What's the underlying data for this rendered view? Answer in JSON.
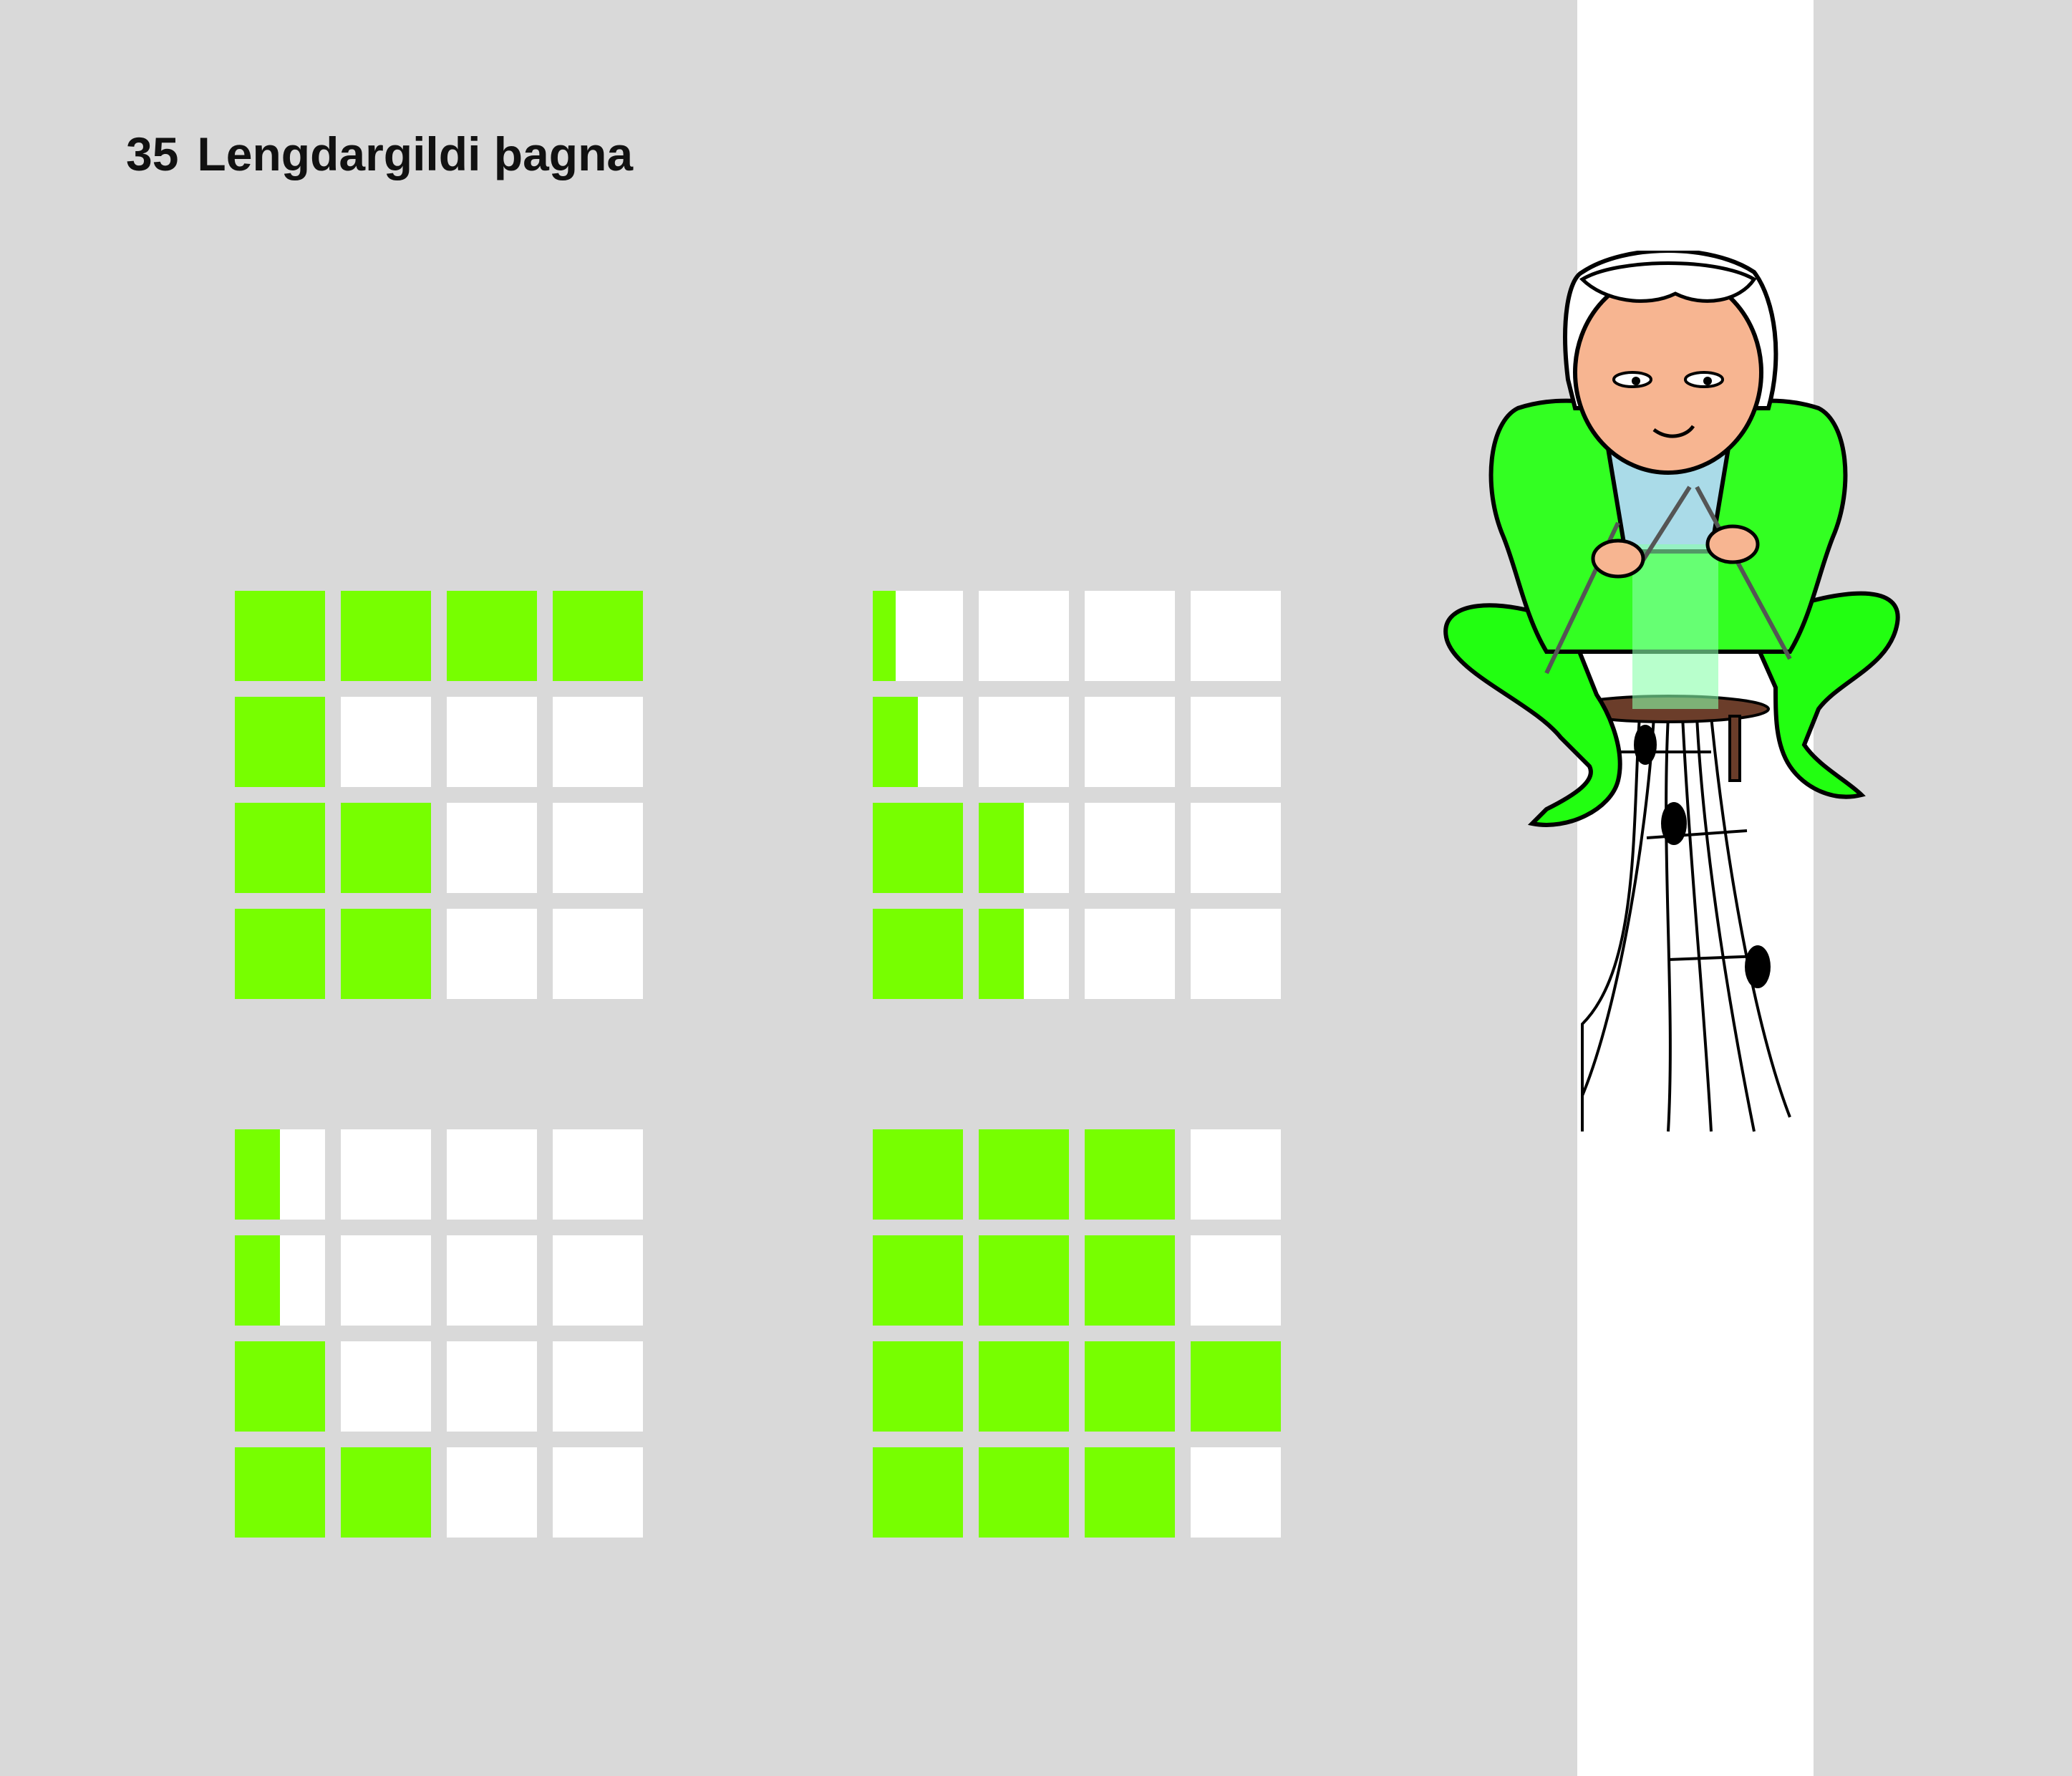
{
  "colors": {
    "background": "#d9d9d9",
    "fill": "#77ff00",
    "empty": "#ffffff",
    "strip": "#ffffff",
    "text": "#111111"
  },
  "header": {
    "number": "35",
    "title": "Lengdargildi þagna"
  },
  "grids": [
    {
      "position": "top-left",
      "fill": [
        [
          1,
          1,
          1,
          1
        ],
        [
          1,
          0,
          0,
          0
        ],
        [
          1,
          1,
          0,
          0
        ],
        [
          1,
          1,
          0,
          0
        ]
      ]
    },
    {
      "position": "top-right",
      "fill": [
        [
          0.25,
          0,
          0,
          0
        ],
        [
          0.5,
          0,
          0,
          0
        ],
        [
          1,
          0.5,
          0,
          0
        ],
        [
          1,
          0.5,
          0,
          0
        ]
      ]
    },
    {
      "position": "bottom-left",
      "fill": [
        [
          0.5,
          0,
          0,
          0
        ],
        [
          0.5,
          0,
          0,
          0
        ],
        [
          1,
          0,
          0,
          0
        ],
        [
          1,
          1,
          0,
          0
        ]
      ]
    },
    {
      "position": "bottom-right",
      "fill": [
        [
          1,
          1,
          1,
          0
        ],
        [
          1,
          1,
          1,
          0
        ],
        [
          1,
          1,
          1,
          1
        ],
        [
          1,
          1,
          1,
          0
        ]
      ]
    }
  ],
  "illustration": {
    "subject": "knitting musician sitting on stool, knitting a music staff",
    "icon": "knitter-illustration"
  }
}
